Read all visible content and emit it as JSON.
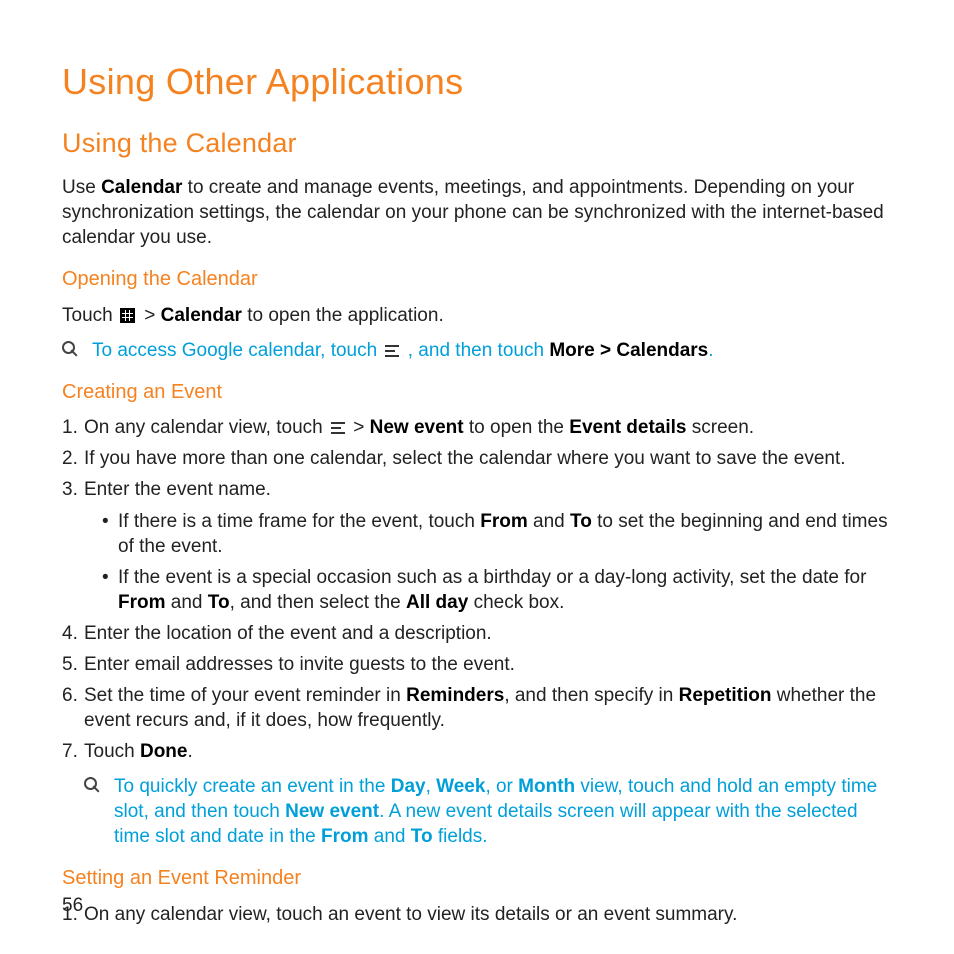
{
  "page_number": "56",
  "h1": "Using Other Applications",
  "h2": "Using the Calendar",
  "intro": {
    "pre": "Use ",
    "b1": "Calendar",
    "post": " to create and manage events, meetings, and appointments. Depending on your synchronization settings, the calendar on your phone can be synchronized with the internet-based calendar you use."
  },
  "sec_open": {
    "title": "Opening the Calendar",
    "line1_pre": "Touch ",
    "line1_mid": " > ",
    "line1_b": "Calendar",
    "line1_post": " to open the application.",
    "tip_pre": "To access Google calendar,  touch ",
    "tip_mid": " , and then touch ",
    "tip_b1": "More",
    "tip_gt": " > ",
    "tip_b2": "Calendars",
    "tip_end": "."
  },
  "sec_create": {
    "title": "Creating an Event",
    "items": [
      {
        "num": "1.",
        "pre": "On any calendar view, touch ",
        "mid": " > ",
        "b1": "New event",
        "post1": " to open the ",
        "b2": "Event details",
        "post2": " screen."
      },
      {
        "num": "2.",
        "text": "If you have more than one calendar, select the calendar where you want to save the event."
      },
      {
        "num": "3.",
        "text": "Enter the event name.",
        "sub": [
          {
            "pre": "If there is a time frame for the event, touch ",
            "b1": "From",
            "mid1": " and ",
            "b2": "To",
            "post": " to set the beginning and end times of the event."
          },
          {
            "pre": "If the event is a special occasion such as a birthday or a day-long activity, set the date for ",
            "b1": "From",
            "mid1": " and ",
            "b2": "To",
            "mid2": ", and then select the ",
            "b3": "All day",
            "post": " check box."
          }
        ]
      },
      {
        "num": "4.",
        "text": "Enter the location of the event and a description."
      },
      {
        "num": "5.",
        "text": "Enter email addresses to invite guests to the event."
      },
      {
        "num": "6.",
        "pre": "Set the time of your event reminder in ",
        "b1": "Reminders",
        "mid1": ", and then specify in ",
        "b2": "Repetition",
        "post": " whether the event recurs and, if it does, how frequently."
      },
      {
        "num": "7.",
        "pre": "Touch ",
        "b1": "Done",
        "post": "."
      }
    ],
    "tip": {
      "t1": "To quickly create an event in the ",
      "b1": "Day",
      "c1": ", ",
      "b2": "Week",
      "c2": ", or ",
      "b3": "Month",
      "t2": " view, touch and hold an empty time slot, and then touch ",
      "b4": "New event",
      "t3": ". A new event details screen will appear with the selected time slot and date in the ",
      "b5": "From",
      "c3": " and ",
      "b6": "To",
      "t4": " fields."
    }
  },
  "sec_reminder": {
    "title": "Setting an Event Reminder",
    "item1_num": "1.",
    "item1_text": "On any calendar view, touch an event to view its details or an event summary."
  }
}
